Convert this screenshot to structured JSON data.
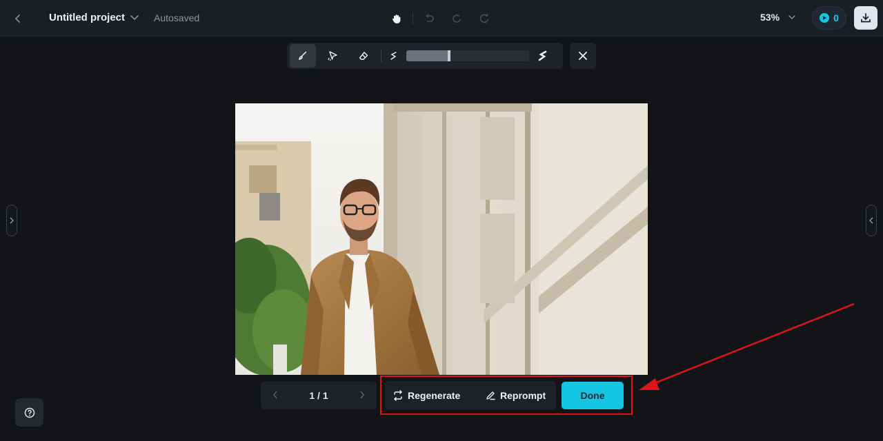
{
  "header": {
    "project_title": "Untitled project",
    "save_status": "Autosaved",
    "zoom_level": "53%",
    "credits_count": "0"
  },
  "pager": {
    "text": "1 / 1"
  },
  "actions": {
    "regenerate_label": "Regenerate",
    "reprompt_label": "Reprompt",
    "done_label": "Done"
  },
  "brush": {
    "size_fraction": 0.35
  },
  "icons": {
    "back": "chevron-left-icon",
    "title_menu": "chevron-down-icon",
    "pan": "hand-icon",
    "undo": "undo-icon",
    "redo": "redo-icon",
    "refresh": "refresh-icon",
    "brush": "brush-icon",
    "smart_select": "smart-select-icon",
    "eraser": "eraser-icon",
    "small_brush": "small-brush-icon",
    "large_brush": "large-brush-icon",
    "close": "close-icon",
    "download": "download-icon",
    "help": "help-icon"
  },
  "colors": {
    "accent": "#14c6e4",
    "highlight": "#e0131a",
    "background": "#121418"
  }
}
